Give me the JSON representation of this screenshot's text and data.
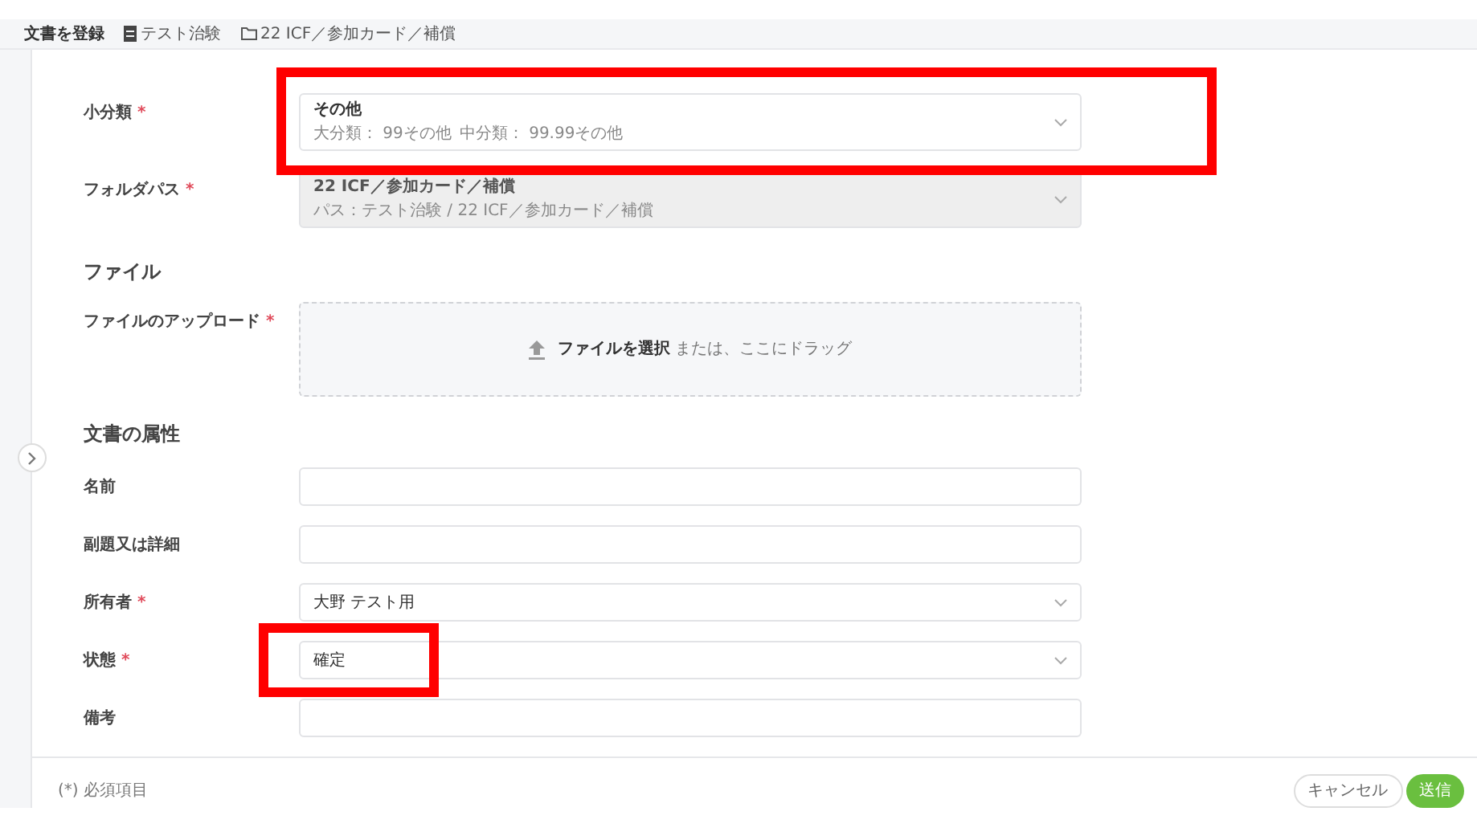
{
  "breadcrumb": [
    {
      "kind": "title",
      "text": "文書を登録"
    },
    {
      "kind": "study",
      "text": "テスト治験"
    },
    {
      "kind": "folder",
      "text": "22 ICF／参加カード／補償"
    }
  ],
  "form": [
    {
      "kind": "select",
      "label": "小分類",
      "required_mark": "*",
      "value": "その他",
      "details": [
        "大分類： 99その他",
        "中分類： 99.99その他"
      ],
      "disabled": false,
      "highlighted": true
    },
    {
      "kind": "select",
      "label": "フォルダパス",
      "required_mark": "*",
      "value": "22 ICF／参加カード／補償",
      "details": [
        "パス：テスト治験 / 22 ICF／参加カード／補償"
      ],
      "disabled": true
    },
    {
      "kind": "heading",
      "label": "ファイル"
    },
    {
      "kind": "upload",
      "label": "ファイルのアップロード",
      "required_mark": "*",
      "action": "ファイルを選択",
      "hint": "または、ここにドラッグ"
    },
    {
      "kind": "heading",
      "label": "文書の属性"
    },
    {
      "kind": "text",
      "label": "名前"
    },
    {
      "kind": "text",
      "label": "副題又は詳細"
    },
    {
      "kind": "select",
      "label": "所有者",
      "required_mark": "*",
      "value": "大野 テスト用",
      "disabled": false
    },
    {
      "kind": "select",
      "label": "状態",
      "required_mark": "*",
      "value": "確定",
      "disabled": false,
      "highlighted": true
    },
    {
      "kind": "text",
      "label": "備考"
    }
  ],
  "footer": {
    "note": "(*) 必須項目",
    "buttons": [
      {
        "kind": "secondary",
        "text": "キャンセル"
      },
      {
        "kind": "primary",
        "text": "送信"
      }
    ]
  }
}
